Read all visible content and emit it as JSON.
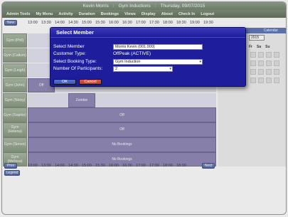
{
  "header": {
    "user": "Kevin Morris",
    "section": "Gym Inductions",
    "separator": ":",
    "date": "Thursday, 09/07/2015"
  },
  "menu": [
    "Admin Tools",
    "My Menu",
    "Activity",
    "Duration",
    "Bookings",
    "Views",
    "Display",
    "About",
    "Check In",
    "Logout"
  ],
  "nav": {
    "new_label": "New",
    "prev_label": "Prev",
    "next_label": "Next",
    "legend_label": "Legend"
  },
  "times": [
    "13:00",
    "13:30",
    "14:00",
    "14:30",
    "15:00",
    "15:30",
    "16:00",
    "16:30",
    "17:00",
    "17:30",
    "18:00",
    "18:30",
    "19:00",
    "19:30"
  ],
  "bottom_times": [
    "13:00",
    "13:30",
    "14:00",
    "14:30",
    "15:00",
    "15:30",
    "16:00",
    "16:30",
    "17:00",
    "17:30",
    "18:00",
    "18:30"
  ],
  "rows": [
    {
      "name": "Gym (Phil)",
      "block": null
    },
    {
      "name": "Gym (Callum)",
      "block": null
    },
    {
      "name": "Gym (Leigh)",
      "block": null
    },
    {
      "name": "Gym (John)",
      "block": {
        "label": "Off"
      }
    },
    {
      "name": "Gym (Nicky)",
      "block": {
        "label": "Zombie"
      }
    },
    {
      "name": "Gym (Sophie)",
      "block": {
        "label": "Off"
      }
    },
    {
      "name": "Gym (Helena)",
      "block": {
        "label": "Off"
      }
    },
    {
      "name": "Gym (Simon)",
      "block": {
        "label": "No Bookings"
      }
    },
    {
      "name": "Gym (Melissa)",
      "block": {
        "label": "No Bookings"
      }
    }
  ],
  "calendar": {
    "title": "Calendar",
    "year": "2015",
    "days": [
      "Fr",
      "Sa",
      "Su"
    ]
  },
  "dialog": {
    "title": "Select Member",
    "member_label": "Select Member",
    "member_value": "Morris Kevin (001.000)",
    "customer_type_label": "Customer Type:",
    "customer_type_value": "OffPeak (ACTIVE)",
    "booking_type_label": "Select Booking Type:",
    "booking_type_value": "Gym Induction",
    "participants_label": "Number Of Participants:",
    "participants_value": "2",
    "ok_label": "OK",
    "cancel_label": "Cancel"
  },
  "colors": {
    "dialog_bg": "#1e1e9c",
    "ok_button": "#3b55b5",
    "cancel_button": "#c0392b",
    "block": "#8d86b5",
    "name_cell": "#98a892"
  }
}
